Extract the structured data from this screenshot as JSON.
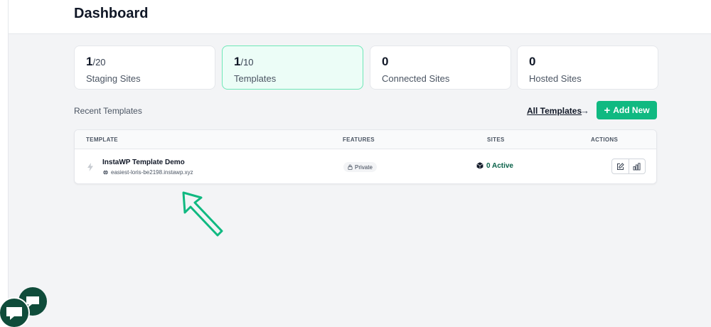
{
  "header": {
    "title": "Dashboard"
  },
  "stats": [
    {
      "value": "1",
      "total": "/20",
      "label": "Staging Sites"
    },
    {
      "value": "1",
      "total": "/10",
      "label": "Templates"
    },
    {
      "value": "0",
      "total": "",
      "label": "Connected Sites"
    },
    {
      "value": "0",
      "total": "",
      "label": "Hosted Sites"
    }
  ],
  "recent": {
    "title": "Recent Templates",
    "all_link": "All Templates",
    "arrow": "→",
    "add_button": {
      "plus": "+",
      "label": "Add New"
    }
  },
  "table": {
    "columns": [
      "TEMPLATE",
      "FEATURES",
      "SITES",
      "ACTIONS"
    ],
    "rows": [
      {
        "name": "InstaWP Template Demo",
        "url": "easiest-loris-be2198.instawp.xyz",
        "feature": "Private",
        "sites": "0 Active"
      }
    ]
  },
  "icons": {
    "row": "bolt-icon",
    "url": "globe-icon",
    "feature": "lock-icon",
    "sites": "cube-icon",
    "actions": [
      "edit-icon",
      "chart-icon"
    ],
    "chat": "chat-icon"
  },
  "colors": {
    "accent": "#10b981",
    "active_card_bg": "#ecfdf7",
    "active_card_border": "#6ee7b7",
    "chat_bubble": "#0f4c3a",
    "active_text": "#065f46"
  }
}
